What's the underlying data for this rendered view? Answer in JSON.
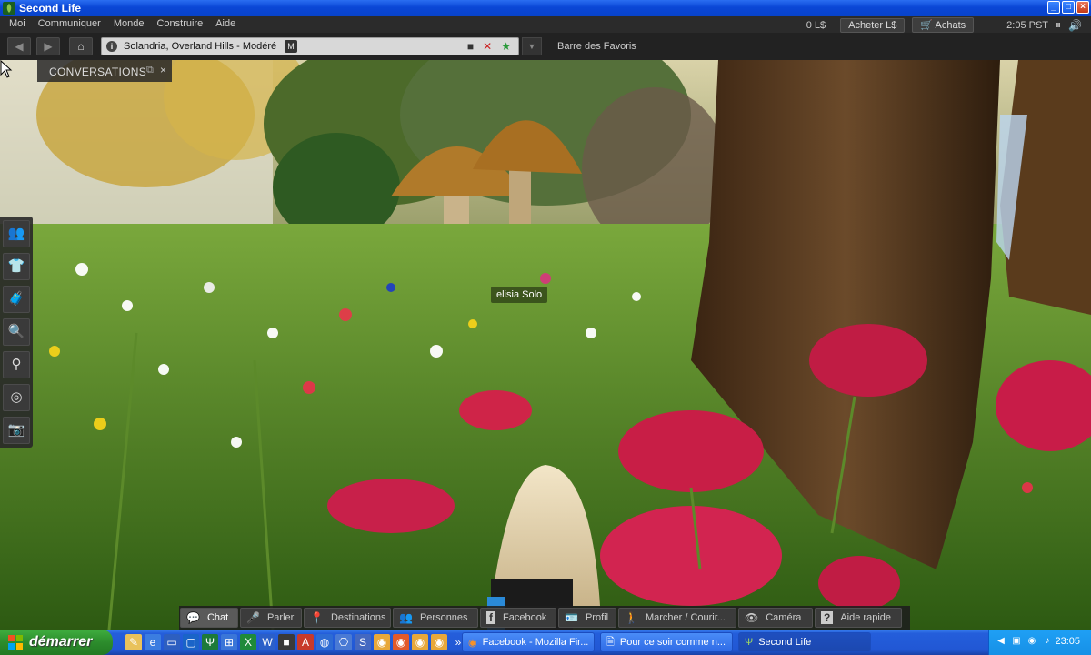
{
  "window": {
    "title": "Second Life",
    "controls": [
      "_",
      "□",
      "×"
    ]
  },
  "menubar": {
    "items": [
      "Moi",
      "Communiquer",
      "Monde",
      "Construire",
      "Aide"
    ],
    "balance": "0 L$",
    "buy_button": "Acheter L$",
    "shop_button": "Achats",
    "clock": "2:05 PST"
  },
  "navbar": {
    "location": "Solandria, Overland Hills - Modéré",
    "rating_badge": "M",
    "favorites_label": "Barre des Favoris"
  },
  "conversations": {
    "label": "CONVERSATIONS"
  },
  "world": {
    "avatar_name": "elisia Solo"
  },
  "side_toolbar": {
    "buttons": [
      "people-icon",
      "shirt-icon",
      "inventory-icon",
      "search-icon",
      "destinations-icon",
      "radar-icon",
      "snapshot-icon"
    ]
  },
  "bottom_toolbar": {
    "buttons": [
      {
        "label": "Chat",
        "icon": "chat-bubble-icon"
      },
      {
        "label": "Parler",
        "icon": "microphone-icon"
      },
      {
        "label": "Destinations",
        "icon": "map-pin-icon"
      },
      {
        "label": "Personnes",
        "icon": "people-icon"
      },
      {
        "label": "Facebook",
        "icon": "facebook-icon"
      },
      {
        "label": "Profil",
        "icon": "profile-card-icon"
      },
      {
        "label": "Marcher / Courir...",
        "icon": "walk-icon"
      },
      {
        "label": "Caméra",
        "icon": "eye-icon"
      },
      {
        "label": "Aide rapide",
        "icon": "help-icon"
      }
    ]
  },
  "taskbar": {
    "start_label": "démarrer",
    "tasks": [
      {
        "label": "Facebook - Mozilla Fir...",
        "icon": "firefox-icon"
      },
      {
        "label": "Pour ce soir comme n...",
        "icon": "document-icon"
      },
      {
        "label": "Second Life",
        "icon": "second-life-icon"
      }
    ],
    "clock": "23:05"
  },
  "colors": {
    "xp_blue": "#245edb",
    "start_green": "#2c8c2c",
    "sl_dark": "#2b2b2b"
  }
}
